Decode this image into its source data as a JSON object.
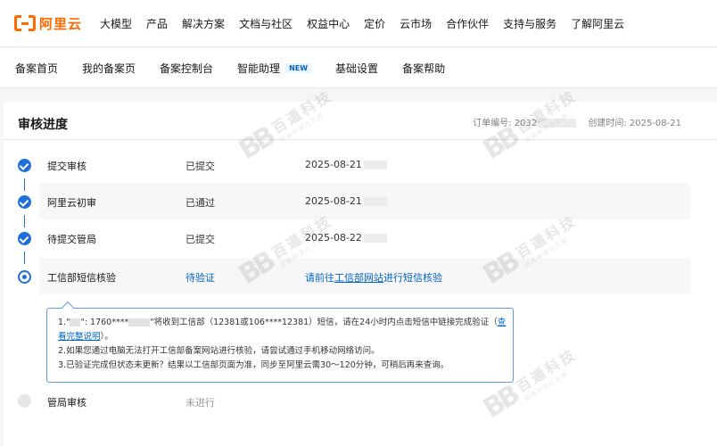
{
  "brand": {
    "logo_text": "阿里云",
    "accent": "#ff6a00"
  },
  "topnav": [
    "大模型",
    "产品",
    "解决方案",
    "文档与社区",
    "权益中心",
    "定价",
    "云市场",
    "合作伙伴",
    "支持与服务",
    "了解阿里云"
  ],
  "subnav": [
    {
      "label": "备案首页"
    },
    {
      "label": "我的备案页"
    },
    {
      "label": "备案控制台"
    },
    {
      "label": "智能助理",
      "badge": "NEW"
    },
    {
      "label": "基础设置"
    },
    {
      "label": "备案帮助"
    }
  ],
  "card": {
    "title": "审核进度",
    "order_label": "订单编号: 2032",
    "created_label": "创建时间: 2025-08-21"
  },
  "steps": [
    {
      "name": "提交审核",
      "status": "已提交",
      "date": "2025-08-21",
      "state": "done"
    },
    {
      "name": "阿里云初审",
      "status": "已通过",
      "date": "2025-08-21",
      "state": "done"
    },
    {
      "name": "待提交管局",
      "status": "已提交",
      "date": "2025-08-22",
      "state": "done"
    },
    {
      "name": "工信部短信核验",
      "status": "待验证",
      "action_prefix": "请前往",
      "action_link": "工信部网站",
      "action_suffix": "进行短信核验",
      "state": "current"
    },
    {
      "name": "管局审核",
      "status": "未进行",
      "state": "pending"
    }
  ],
  "notice": {
    "line1_a": "1.\"",
    "line1_b": "\": 1760****",
    "line1_c": "\"将收到工信部（12381或106****12381）短信，请在24小时内点击短信中链接完成验证（",
    "line1_link_a": "查",
    "line1_link_b": "看完整说明",
    "line1_end": "）。",
    "line2": "2.如果您通过电脑无法打开工信部备案网站进行核验，请尝试通过手机移动网络访问。",
    "line3": "3.已验证完成但状态未更新？结果以工信部页面为准，同步至阿里云需30～120分钟，可稍后再来查询。"
  },
  "watermark": {
    "mark": "BB",
    "name": "百遁科技",
    "sub": "资格申请找百遁"
  },
  "colors": {
    "primary": "#0064c8",
    "step_done": "#1f6fd8",
    "pending": "#e6e6e6"
  }
}
